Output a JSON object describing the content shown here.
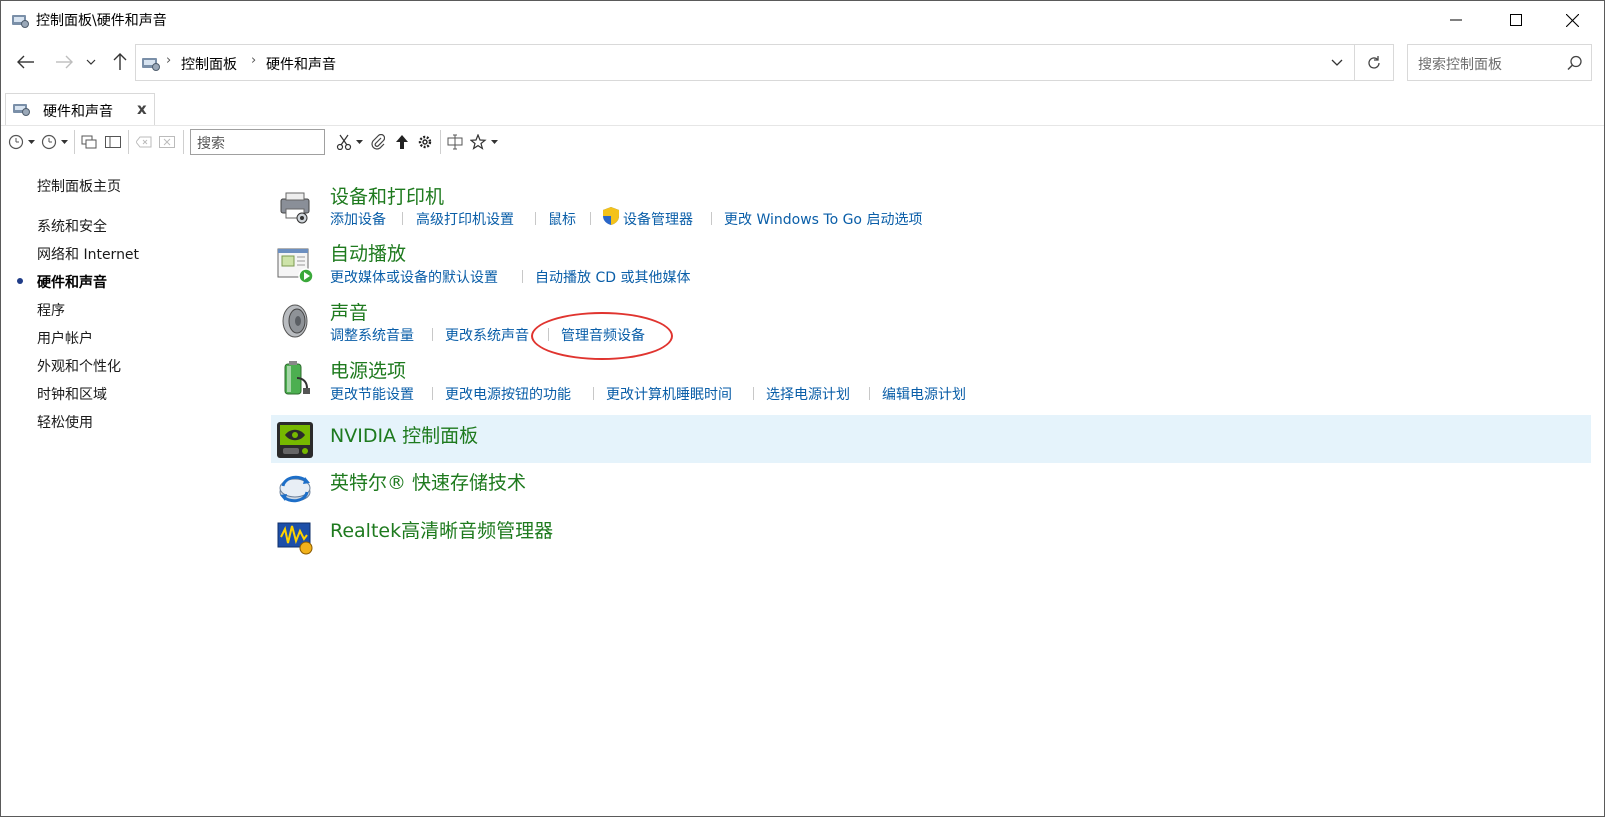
{
  "window": {
    "title": "控制面板\\硬件和声音"
  },
  "address": {
    "crumbs": [
      "控制面板",
      "硬件和声音"
    ],
    "search_placeholder": "搜索控制面板"
  },
  "tab": {
    "label": "硬件和声音",
    "close": "x"
  },
  "toolbar": {
    "search_placeholder": "搜索"
  },
  "sidebar": {
    "home": "控制面板主页",
    "items": [
      "系统和安全",
      "网络和 Internet",
      "硬件和声音",
      "程序",
      "用户帐户",
      "外观和个性化",
      "时钟和区域",
      "轻松使用"
    ],
    "current_index": 2
  },
  "categories": [
    {
      "title": "设备和打印机",
      "links": [
        "添加设备",
        "高级打印机设置",
        "鼠标",
        "设备管理器",
        "更改 Windows To Go 启动选项"
      ]
    },
    {
      "title": "自动播放",
      "links": [
        "更改媒体或设备的默认设置",
        "自动播放 CD 或其他媒体"
      ]
    },
    {
      "title": "声音",
      "links": [
        "调整系统音量",
        "更改系统声音",
        "管理音频设备"
      ]
    },
    {
      "title": "电源选项",
      "links": [
        "更改节能设置",
        "更改电源按钮的功能",
        "更改计算机睡眠时间",
        "选择电源计划",
        "编辑电源计划"
      ]
    },
    {
      "title": "NVIDIA 控制面板",
      "links": []
    },
    {
      "title": "英特尔® 快速存储技术",
      "links": []
    },
    {
      "title": "Realtek高清晰音频管理器",
      "links": []
    }
  ],
  "colors": {
    "category_title": "#1e7a1e",
    "link": "#0a5ea8",
    "highlight": "#e5f3fb",
    "annotation_circle": "#e0342f"
  }
}
